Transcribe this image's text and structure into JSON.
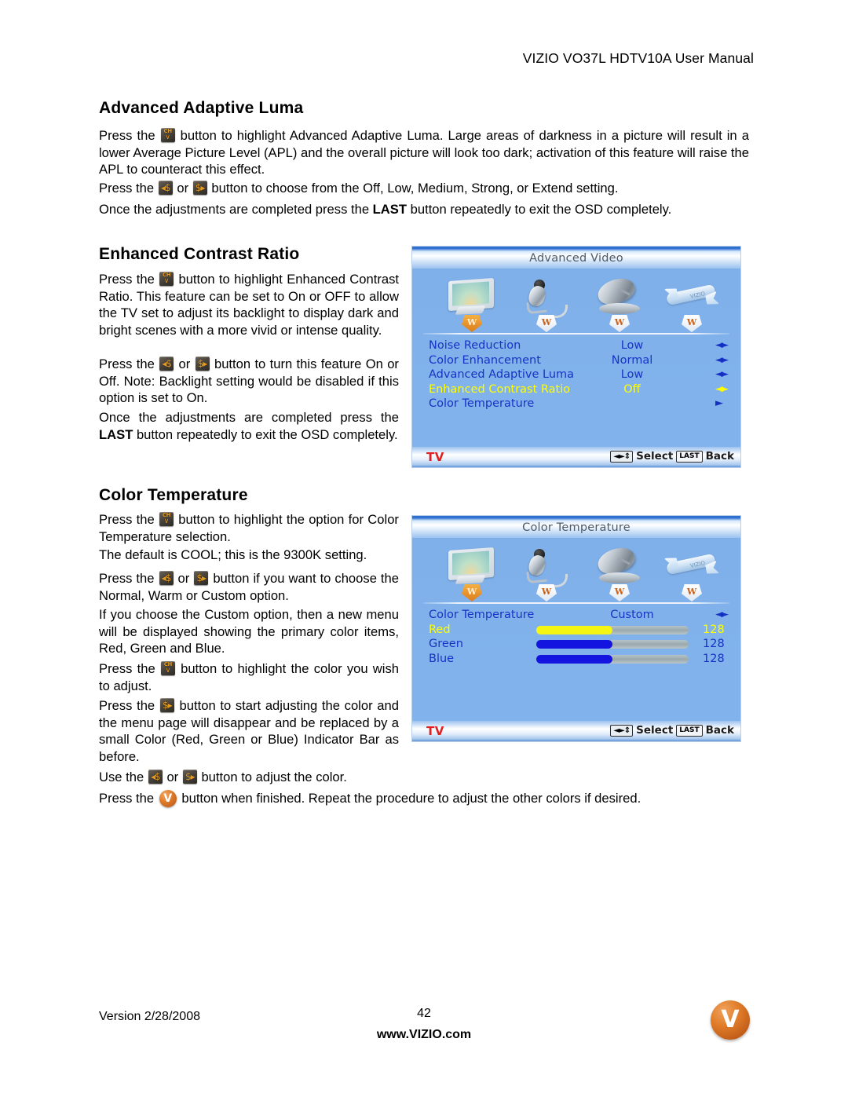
{
  "header": {
    "title": "VIZIO VO37L HDTV10A User Manual"
  },
  "sections": {
    "adaptive_luma": {
      "heading": "Advanced Adaptive Luma",
      "p1_before": "Press the",
      "p1_after": "button to highlight Advanced Adaptive Luma. Large areas of darkness in a picture will result in a lower Average Picture Level (APL) and the overall picture will look too dark; activation of this feature will raise the APL to counteract this effect.",
      "p2_before": "Press the",
      "p2_mid": "or",
      "p2_after": "button to choose from the Off, Low, Medium, Strong, or Extend setting.",
      "p3_a": "Once the adjustments are completed press the",
      "p3_b": "LAST",
      "p3_c": "button repeatedly to exit the OSD completely."
    },
    "enhanced_contrast": {
      "heading": "Enhanced Contrast Ratio",
      "p1_before": "Press the",
      "p1_after": "button to highlight Enhanced Contrast Ratio.  This feature can be set to On or OFF to allow the TV set to adjust its backlight to display dark and bright scenes with a more vivid or intense quality.",
      "p2_before": "Press the",
      "p2_mid": "or",
      "p2_after": "button to turn this feature On or Off. Note: Backlight setting would be disabled if this option is set to On.",
      "p3_a": "Once the adjustments are completed press the",
      "p3_b": "LAST",
      "p3_c": "button repeatedly to exit the OSD completely."
    },
    "color_temperature": {
      "heading": "Color Temperature",
      "p1_before": "Press the",
      "p1_after": "button to highlight the option for Color Temperature selection.",
      "p2": "The default is COOL; this is the 9300K setting.",
      "p3_before": "Press the",
      "p3_mid": "or",
      "p3_after": "button if you want to choose the Normal, Warm or Custom option.",
      "p4": "If you choose the Custom option, then a new menu will be displayed showing the primary color items, Red, Green and Blue.",
      "p5_before": "Press the",
      "p5_after": "button to highlight the color you wish to adjust.",
      "p6_before": "Press the",
      "p6_after": "button to start adjusting the color and the menu page will disappear and be replaced by a small Color (Red, Green or Blue) Indicator Bar as before.",
      "p7_before": "Use the",
      "p7_mid": "or",
      "p7_after": "button to adjust the color.",
      "p8_before": "Press the",
      "p8_after": "button when finished.  Repeat the procedure to adjust the other colors if desired."
    }
  },
  "buttons": {
    "ch_top": "CH",
    "ch_bottom": "∨",
    "left_glyph": "◂$",
    "right_glyph": "$▸",
    "v_glyph": "V"
  },
  "osd_advanced_video": {
    "title": "Advanced Video",
    "icons": [
      {
        "name": "picture-icon",
        "badge": "W"
      },
      {
        "name": "audio-icon",
        "badge": "W"
      },
      {
        "name": "tuner-icon",
        "badge": "W"
      },
      {
        "name": "setup-icon",
        "badge": "W"
      }
    ],
    "rows": [
      {
        "label": "Noise Reduction",
        "value": "Low",
        "arrow": "◄►",
        "selected": false
      },
      {
        "label": "Color Enhancement",
        "value": "Normal",
        "arrow": "◄►",
        "selected": false
      },
      {
        "label": "Advanced Adaptive Luma",
        "value": "Low",
        "arrow": "◄►",
        "selected": false
      },
      {
        "label": "Enhanced Contrast Ratio",
        "value": "Off",
        "arrow": "◄►",
        "selected": true
      },
      {
        "label": "Color Temperature",
        "value": "",
        "arrow": "►",
        "selected": false
      }
    ],
    "footer": {
      "source": "TV",
      "nav_key": "◄►⇕",
      "select_label": "Select",
      "last_key": "LAST",
      "back_label": "Back"
    }
  },
  "osd_color_temperature": {
    "title": "Color Temperature",
    "icons": [
      {
        "name": "picture-icon",
        "badge": "W"
      },
      {
        "name": "audio-icon",
        "badge": "W"
      },
      {
        "name": "tuner-icon",
        "badge": "W"
      },
      {
        "name": "setup-icon",
        "badge": "W"
      }
    ],
    "option_row": {
      "label": "Color Temperature",
      "value": "Custom",
      "arrow": "◄►"
    },
    "sliders": [
      {
        "label": "Red",
        "value": "128",
        "percent": 50,
        "fill": "#f5f514",
        "selected": true
      },
      {
        "label": "Green",
        "value": "128",
        "percent": 50,
        "fill": "#1414e0",
        "selected": false
      },
      {
        "label": "Blue",
        "value": "128",
        "percent": 50,
        "fill": "#1414e0",
        "selected": false
      }
    ],
    "footer": {
      "source": "TV",
      "nav_key": "◄►⇕",
      "select_label": "Select",
      "last_key": "LAST",
      "back_label": "Back"
    }
  },
  "footer": {
    "version": "Version 2/28/2008",
    "page_number": "42",
    "website": "www.VIZIO.com",
    "logo_letter": "V"
  }
}
